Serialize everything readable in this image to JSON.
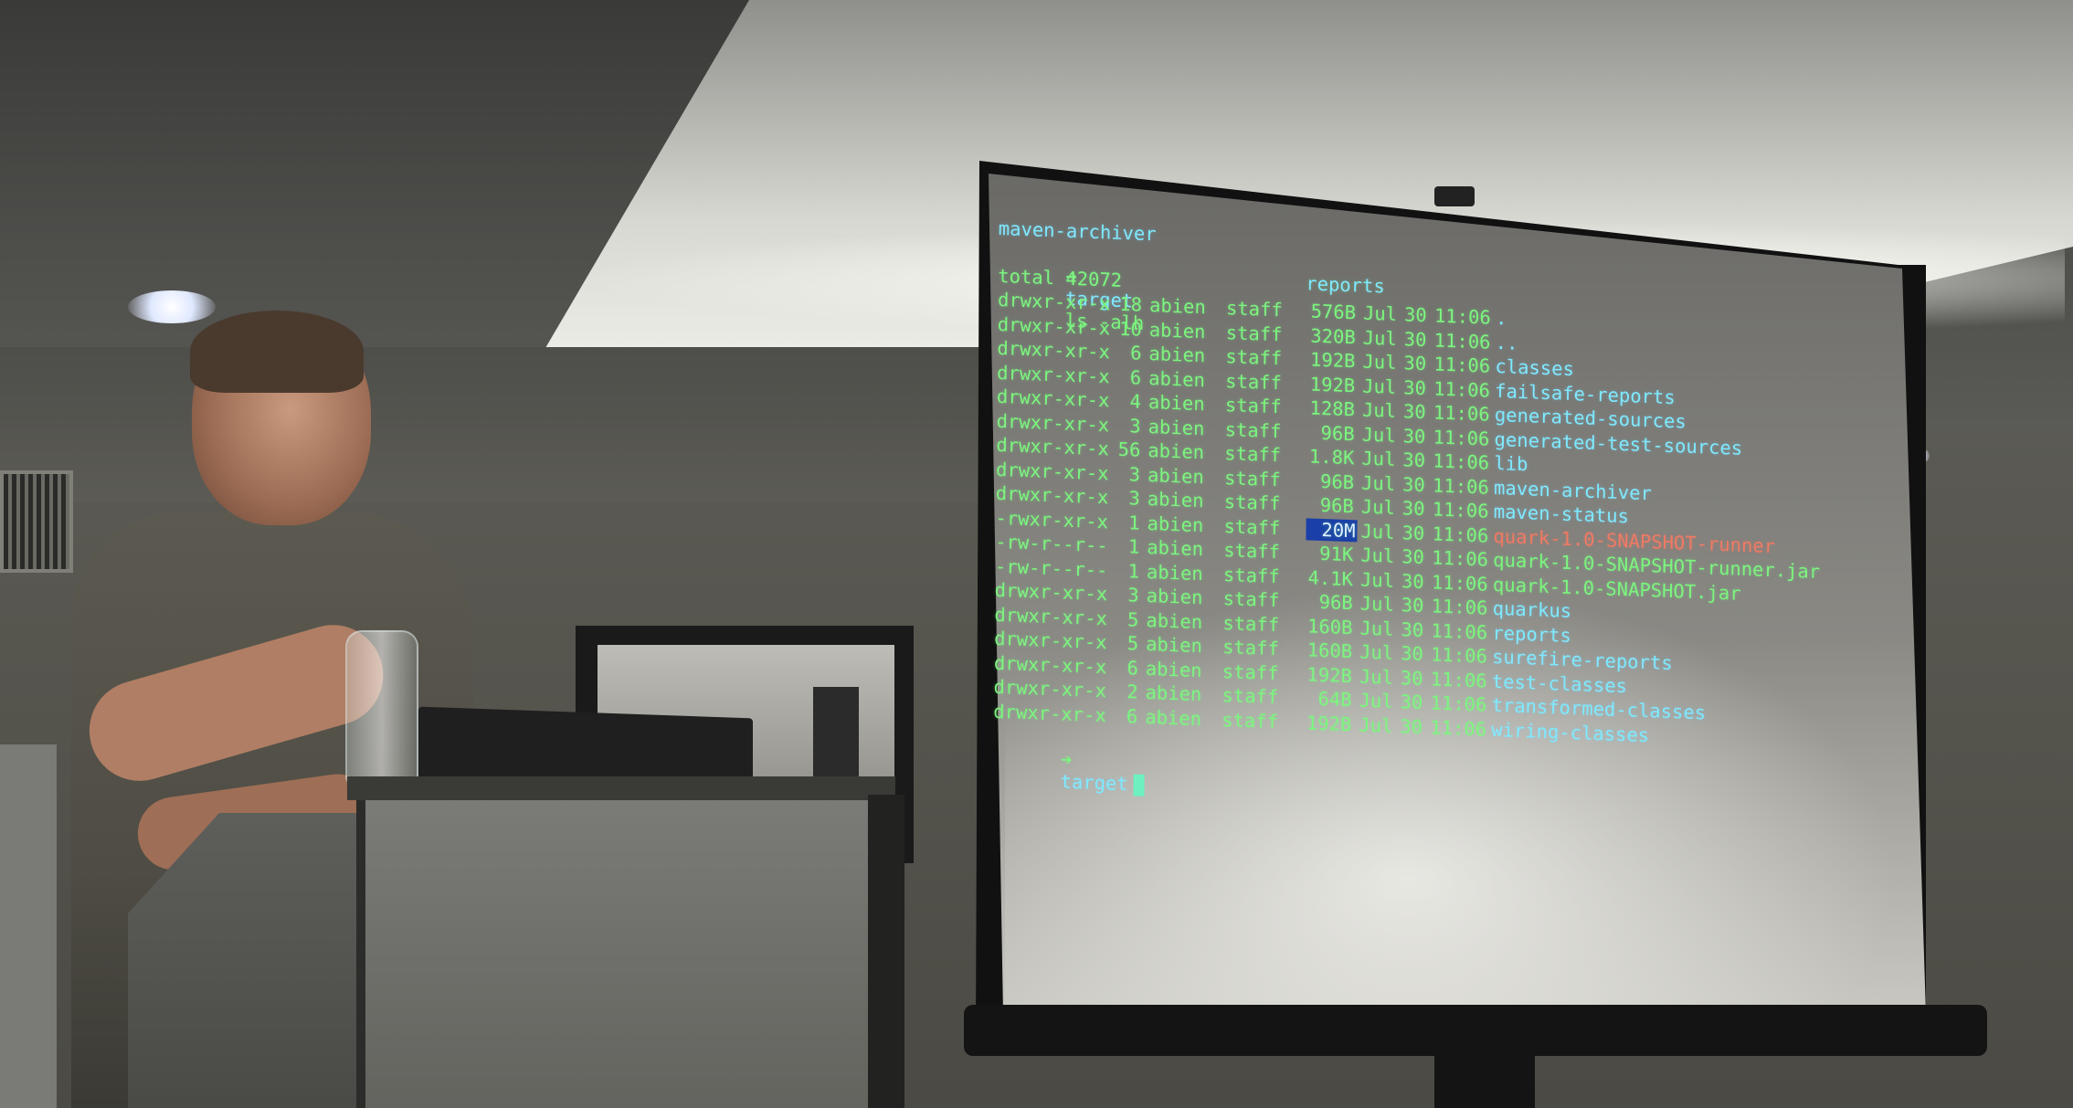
{
  "terminal": {
    "header_left": "maven-archiver",
    "header_right": "reports",
    "prompt_arrow": "➜",
    "prompt_dir": "target",
    "command": "ls -alh",
    "total": "total 42072",
    "rows": [
      {
        "perm": "drwxr-xr-x",
        "links": "18",
        "owner": "abien",
        "group": "staff",
        "size": "576B",
        "month": "Jul",
        "day": "30",
        "time": "11:06",
        "name": ".",
        "kind": "dir"
      },
      {
        "perm": "drwxr-xr-x",
        "links": "10",
        "owner": "abien",
        "group": "staff",
        "size": "320B",
        "month": "Jul",
        "day": "30",
        "time": "11:06",
        "name": "..",
        "kind": "dir"
      },
      {
        "perm": "drwxr-xr-x",
        "links": "6",
        "owner": "abien",
        "group": "staff",
        "size": "192B",
        "month": "Jul",
        "day": "30",
        "time": "11:06",
        "name": "classes",
        "kind": "dir"
      },
      {
        "perm": "drwxr-xr-x",
        "links": "6",
        "owner": "abien",
        "group": "staff",
        "size": "192B",
        "month": "Jul",
        "day": "30",
        "time": "11:06",
        "name": "failsafe-reports",
        "kind": "dir"
      },
      {
        "perm": "drwxr-xr-x",
        "links": "4",
        "owner": "abien",
        "group": "staff",
        "size": "128B",
        "month": "Jul",
        "day": "30",
        "time": "11:06",
        "name": "generated-sources",
        "kind": "dir"
      },
      {
        "perm": "drwxr-xr-x",
        "links": "3",
        "owner": "abien",
        "group": "staff",
        "size": "96B",
        "month": "Jul",
        "day": "30",
        "time": "11:06",
        "name": "generated-test-sources",
        "kind": "dir"
      },
      {
        "perm": "drwxr-xr-x",
        "links": "56",
        "owner": "abien",
        "group": "staff",
        "size": "1.8K",
        "month": "Jul",
        "day": "30",
        "time": "11:06",
        "name": "lib",
        "kind": "dir"
      },
      {
        "perm": "drwxr-xr-x",
        "links": "3",
        "owner": "abien",
        "group": "staff",
        "size": "96B",
        "month": "Jul",
        "day": "30",
        "time": "11:06",
        "name": "maven-archiver",
        "kind": "dir"
      },
      {
        "perm": "drwxr-xr-x",
        "links": "3",
        "owner": "abien",
        "group": "staff",
        "size": "96B",
        "month": "Jul",
        "day": "30",
        "time": "11:06",
        "name": "maven-status",
        "kind": "dir"
      },
      {
        "perm": "-rwxr-xr-x",
        "links": "1",
        "owner": "abien",
        "group": "staff",
        "size": "20M",
        "month": "Jul",
        "day": "30",
        "time": "11:06",
        "name": "quark-1.0-SNAPSHOT-runner",
        "kind": "exec"
      },
      {
        "perm": "-rw-r--r--",
        "links": "1",
        "owner": "abien",
        "group": "staff",
        "size": "91K",
        "month": "Jul",
        "day": "30",
        "time": "11:06",
        "name": "quark-1.0-SNAPSHOT-runner.jar",
        "kind": "file"
      },
      {
        "perm": "-rw-r--r--",
        "links": "1",
        "owner": "abien",
        "group": "staff",
        "size": "4.1K",
        "month": "Jul",
        "day": "30",
        "time": "11:06",
        "name": "quark-1.0-SNAPSHOT.jar",
        "kind": "file"
      },
      {
        "perm": "drwxr-xr-x",
        "links": "3",
        "owner": "abien",
        "group": "staff",
        "size": "96B",
        "month": "Jul",
        "day": "30",
        "time": "11:06",
        "name": "quarkus",
        "kind": "dir"
      },
      {
        "perm": "drwxr-xr-x",
        "links": "5",
        "owner": "abien",
        "group": "staff",
        "size": "160B",
        "month": "Jul",
        "day": "30",
        "time": "11:06",
        "name": "reports",
        "kind": "dir"
      },
      {
        "perm": "drwxr-xr-x",
        "links": "5",
        "owner": "abien",
        "group": "staff",
        "size": "160B",
        "month": "Jul",
        "day": "30",
        "time": "11:06",
        "name": "surefire-reports",
        "kind": "dir"
      },
      {
        "perm": "drwxr-xr-x",
        "links": "6",
        "owner": "abien",
        "group": "staff",
        "size": "192B",
        "month": "Jul",
        "day": "30",
        "time": "11:06",
        "name": "test-classes",
        "kind": "dir"
      },
      {
        "perm": "drwxr-xr-x",
        "links": "2",
        "owner": "abien",
        "group": "staff",
        "size": "64B",
        "month": "Jul",
        "day": "30",
        "time": "11:06",
        "name": "transformed-classes",
        "kind": "dir"
      },
      {
        "perm": "drwxr-xr-x",
        "links": "6",
        "owner": "abien",
        "group": "staff",
        "size": "192B",
        "month": "Jul",
        "day": "30",
        "time": "11:06",
        "name": "wiring-classes",
        "kind": "dir"
      }
    ],
    "final_prompt_dir": "target"
  },
  "colors": {
    "terminal_green": "#7cf57e",
    "directory_cyan": "#7fe9ff",
    "executable_red": "#f07a64",
    "selection_blue": "#1b3fa8"
  }
}
